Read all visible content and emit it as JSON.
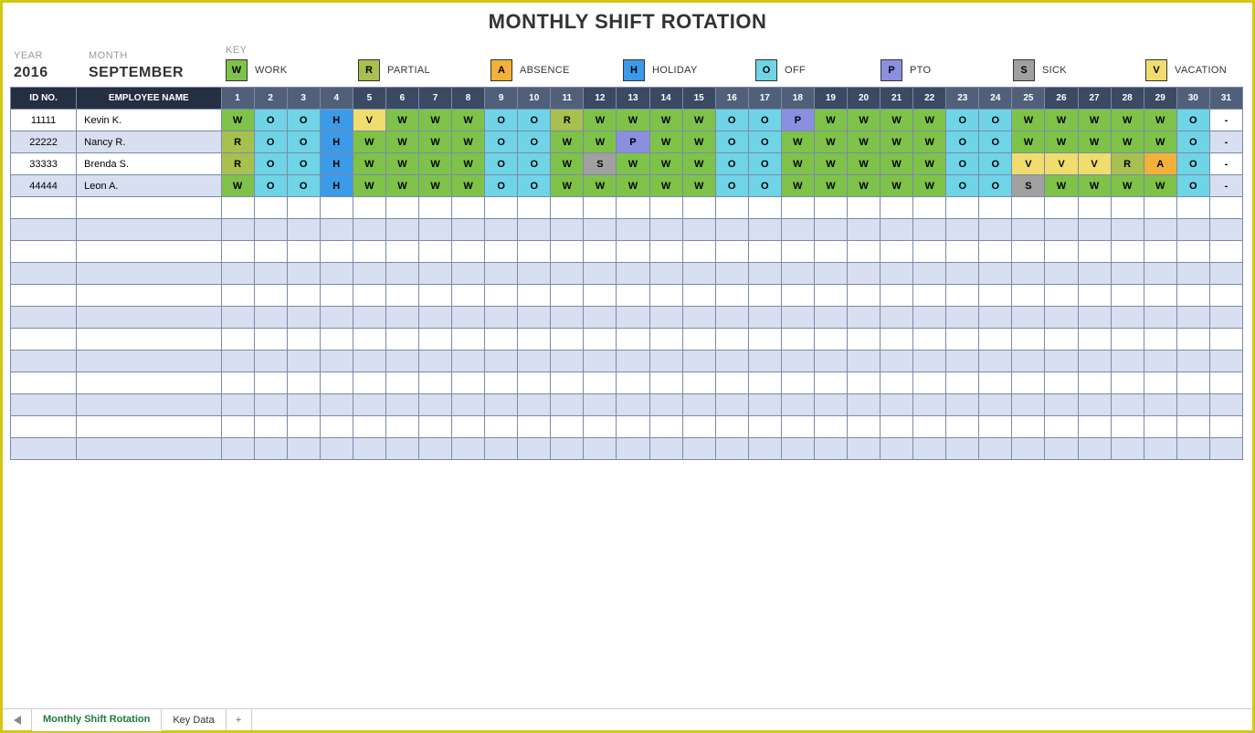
{
  "title": "MONTHLY SHIFT ROTATION",
  "meta": {
    "year_label": "YEAR",
    "year": "2016",
    "month_label": "MONTH",
    "month": "SEPTEMBER",
    "key_label": "KEY"
  },
  "key": [
    {
      "code": "W",
      "label": "WORK",
      "colorClass": "c-W"
    },
    {
      "code": "R",
      "label": "PARTIAL",
      "colorClass": "c-R"
    },
    {
      "code": "A",
      "label": "ABSENCE",
      "colorClass": "c-A"
    },
    {
      "code": "H",
      "label": "HOLIDAY",
      "colorClass": "c-H"
    },
    {
      "code": "O",
      "label": "OFF",
      "colorClass": "c-O"
    },
    {
      "code": "P",
      "label": "PTO",
      "colorClass": "c-P"
    },
    {
      "code": "S",
      "label": "SICK",
      "colorClass": "c-S"
    },
    {
      "code": "V",
      "label": "VACATION",
      "colorClass": "c-V"
    }
  ],
  "headers": {
    "idno": "ID NO.",
    "empname": "EMPLOYEE NAME"
  },
  "days": [
    "1",
    "2",
    "3",
    "4",
    "5",
    "6",
    "7",
    "8",
    "9",
    "10",
    "11",
    "12",
    "13",
    "14",
    "15",
    "16",
    "17",
    "18",
    "19",
    "20",
    "21",
    "22",
    "23",
    "24",
    "25",
    "26",
    "27",
    "28",
    "29",
    "30",
    "31"
  ],
  "dark_days": [
    5,
    6,
    7,
    8,
    12,
    13,
    14,
    15,
    19,
    20,
    21,
    22,
    26,
    27,
    28,
    29
  ],
  "rows": [
    {
      "id": "11111",
      "name": "Kevin K.",
      "codes": [
        "W",
        "O",
        "O",
        "H",
        "V",
        "W",
        "W",
        "W",
        "O",
        "O",
        "R",
        "W",
        "W",
        "W",
        "W",
        "O",
        "O",
        "P",
        "W",
        "W",
        "W",
        "W",
        "O",
        "O",
        "W",
        "W",
        "W",
        "W",
        "W",
        "O",
        "-"
      ]
    },
    {
      "id": "22222",
      "name": "Nancy R.",
      "codes": [
        "R",
        "O",
        "O",
        "H",
        "W",
        "W",
        "W",
        "W",
        "O",
        "O",
        "W",
        "W",
        "P",
        "W",
        "W",
        "O",
        "O",
        "W",
        "W",
        "W",
        "W",
        "W",
        "O",
        "O",
        "W",
        "W",
        "W",
        "W",
        "W",
        "O",
        "-"
      ]
    },
    {
      "id": "33333",
      "name": "Brenda S.",
      "codes": [
        "R",
        "O",
        "O",
        "H",
        "W",
        "W",
        "W",
        "W",
        "O",
        "O",
        "W",
        "S",
        "W",
        "W",
        "W",
        "O",
        "O",
        "W",
        "W",
        "W",
        "W",
        "W",
        "O",
        "O",
        "V",
        "V",
        "V",
        "R",
        "A",
        "O",
        "-"
      ]
    },
    {
      "id": "44444",
      "name": "Leon A.",
      "codes": [
        "W",
        "O",
        "O",
        "H",
        "W",
        "W",
        "W",
        "W",
        "O",
        "O",
        "W",
        "W",
        "W",
        "W",
        "W",
        "O",
        "O",
        "W",
        "W",
        "W",
        "W",
        "W",
        "O",
        "O",
        "S",
        "W",
        "W",
        "W",
        "W",
        "O",
        "-"
      ]
    }
  ],
  "empty_rows": 12,
  "tabs": {
    "active": "Monthly Shift Rotation",
    "others": [
      "Key Data"
    ]
  },
  "colors": {
    "W": "c-W",
    "R": "c-R",
    "A": "c-A",
    "H": "c-H",
    "O": "c-O",
    "P": "c-P",
    "S": "c-S",
    "V": "c-V"
  }
}
